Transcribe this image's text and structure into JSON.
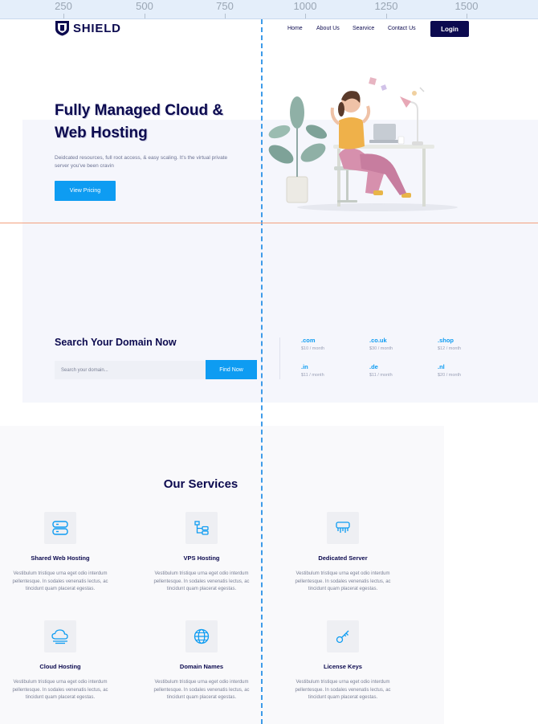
{
  "ruler": [
    "250",
    "500",
    "750",
    "1000",
    "1250",
    "1500"
  ],
  "brand": {
    "name": "SHIELD",
    "logo_icon": "shield-logo-icon"
  },
  "nav": {
    "items": [
      "Home",
      "About Us",
      "Searvice",
      "Contact Us"
    ],
    "login_label": "Login"
  },
  "hero": {
    "title_line1": "Fully Managed Cloud &",
    "title_line2": "Web Hosting",
    "description": "Deidcated resources, full root access, & easy scaling. It's the virtual private server you've been cravin",
    "cta_label": "View Pricing"
  },
  "domain": {
    "title": "Search Your Domain Now",
    "placeholder": "Search your domain...",
    "button_label": "Find Now",
    "tlds": [
      {
        "name": ".com",
        "price": "$10 / month"
      },
      {
        "name": ".co.uk",
        "price": "$30 / month"
      },
      {
        "name": ".shop",
        "price": "$12 / month"
      },
      {
        "name": ".in",
        "price": "$11 / month"
      },
      {
        "name": ".de",
        "price": "$11 / month"
      },
      {
        "name": ".nl",
        "price": "$20 / month"
      }
    ]
  },
  "services": {
    "heading": "Our Services",
    "items": [
      {
        "title": "Shared Web Hosting",
        "icon": "server-icon",
        "desc1": "Vestibulum tristique urna eget odio interdum",
        "desc2": "pellentesque. In sodales venenatis lectus, ac",
        "desc3": "tincidunt quam placerat egestas."
      },
      {
        "title": "VPS  Hosting",
        "icon": "network-tree-icon",
        "desc1": "Vestibulum tristique urna eget odio interdum",
        "desc2": "pellentesque. In sodales venenatis lectus, ac",
        "desc3": "tincidunt quam placerat egestas."
      },
      {
        "title": "Dedicated Server",
        "icon": "dedicated-server-icon",
        "desc1": "Vestibulum tristique urna eget odio interdum",
        "desc2": "pellentesque. In sodales venenatis lectus, ac",
        "desc3": "tincidunt quam placerat egestas."
      },
      {
        "title": "Cloud Hosting",
        "icon": "cloud-icon",
        "desc1": "Vestibulum tristique urna eget odio interdum",
        "desc2": "pellentesque. In sodales venenatis lectus, ac",
        "desc3": "tincidunt quam placerat egestas."
      },
      {
        "title": "Domain Names",
        "icon": "globe-icon",
        "desc1": "Vestibulum tristique urna eget odio interdum",
        "desc2": "pellentesque. In sodales venenatis lectus, ac",
        "desc3": "tincidunt quam placerat egestas."
      },
      {
        "title": "License Keys",
        "icon": "key-icon",
        "desc1": "Vestibulum tristique urna eget odio interdum",
        "desc2": "pellentesque. In sodales venenatis lectus, ac",
        "desc3": "tincidunt quam placerat egestas."
      }
    ]
  },
  "colors": {
    "primary": "#0c0a4f",
    "accent": "#0e9cf2",
    "panel": "#f5f6fc"
  }
}
